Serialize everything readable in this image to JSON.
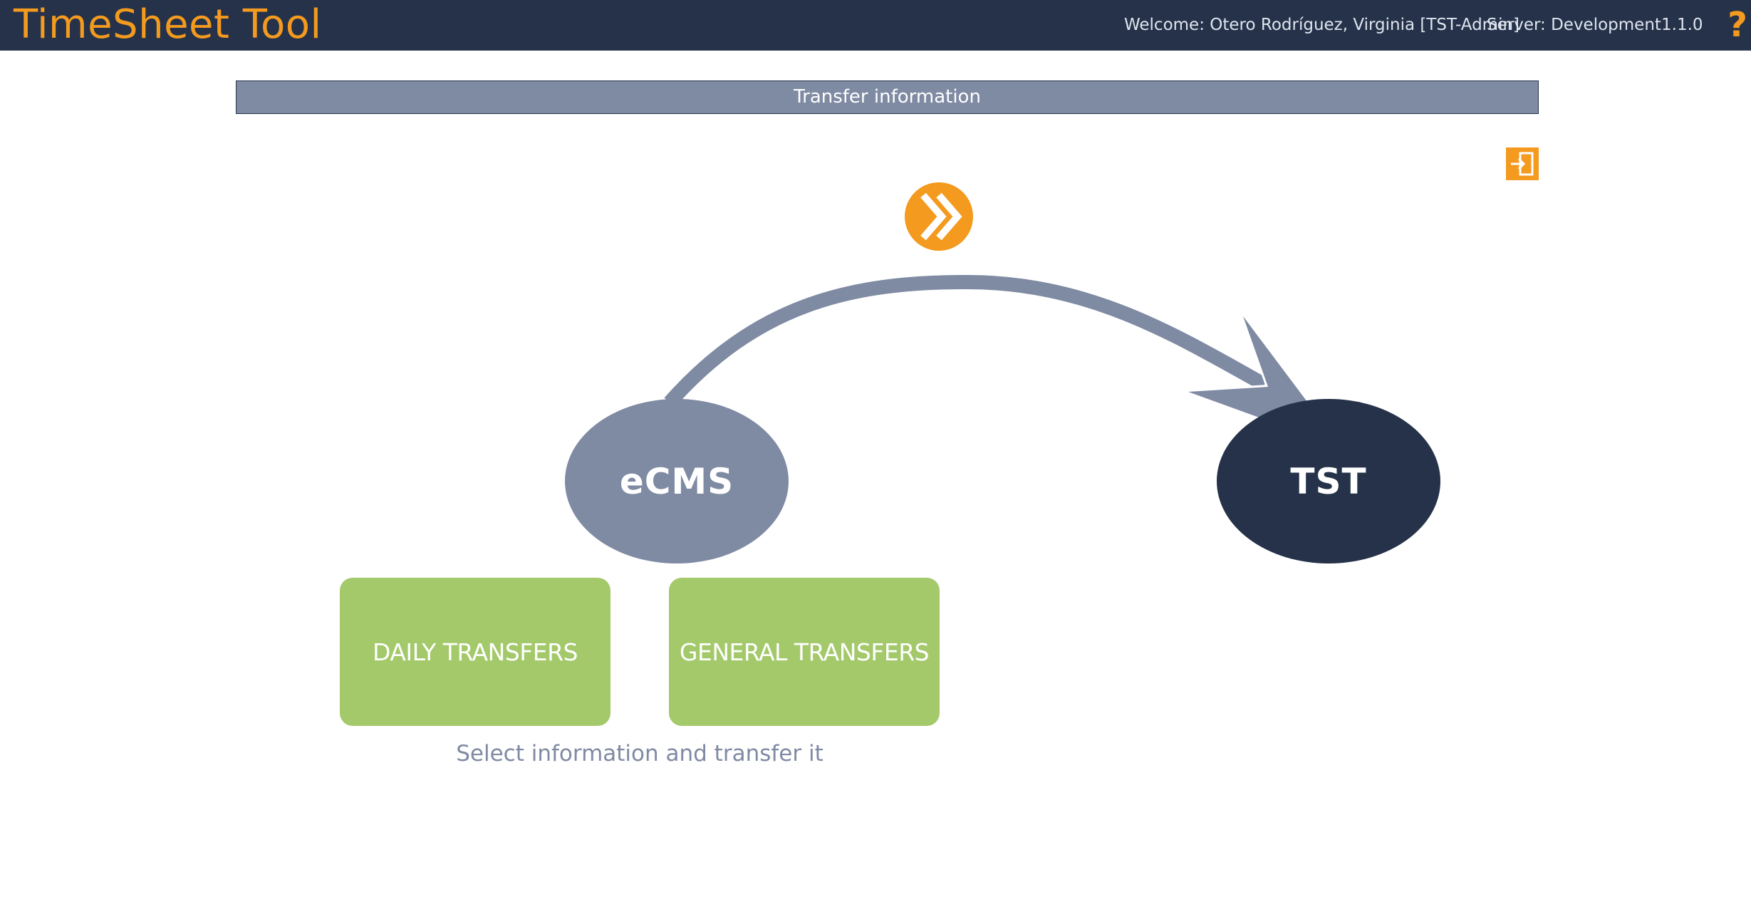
{
  "header": {
    "app_title": "TimeSheet Tool",
    "welcome": "Welcome: Otero Rodríguez, Virginia [TST-Admin]",
    "server": "Server: Development",
    "version": "1.1.0",
    "help_icon": "question-mark-icon"
  },
  "colors": {
    "topbar": "#253249",
    "accent": "#f39a1f",
    "header_band": "#7f8aa3",
    "button_green": "#a3c96a",
    "ecms_node": "#7f8aa3",
    "tst_node": "#253249"
  },
  "main": {
    "section_title": "Transfer information",
    "exit_icon": "exit-door-icon",
    "forward_icon": "double-chevron-right-icon",
    "source_node": "eCMS",
    "target_node": "TST",
    "buttons": {
      "daily": "DAILY TRANSFERS",
      "general": "GENERAL TRANSFERS"
    },
    "hint": "Select information and transfer it"
  }
}
